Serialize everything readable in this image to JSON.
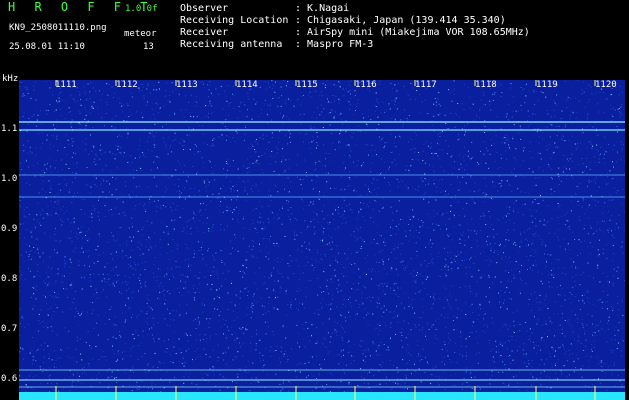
{
  "app": {
    "title": "H R O F F T",
    "version": "1.0.0f"
  },
  "file": {
    "name": "KN9_2508011110.png",
    "datetime": "25.08.01 11:10"
  },
  "meteor": {
    "label": "meteor",
    "count": "13"
  },
  "info": [
    {
      "label": "Observer",
      "value": ": K.Nagai"
    },
    {
      "label": "Receiving Location",
      "value": ": Chigasaki, Japan (139.414 35.340)"
    },
    {
      "label": "Receiver",
      "value": ": AirSpy mini (Miakejima VOR 108.65MHz)"
    },
    {
      "label": "Receiving antenna",
      "value": ": Maspro FM-3"
    }
  ],
  "y_axis": {
    "unit": "kHz",
    "ticks": [
      "1.1",
      "1.0",
      "0.9",
      "0.8",
      "0.7",
      "0.6"
    ]
  },
  "time_ticks": [
    "1111",
    "1112",
    "1113",
    "1114",
    "1115",
    "1116",
    "1117",
    "1118",
    "1119",
    "1120"
  ],
  "colors": {
    "title": "#3cff3c",
    "background": "#0a1f9e",
    "trace": "#7fe8ff",
    "bottom_band": "#29e6ff"
  }
}
